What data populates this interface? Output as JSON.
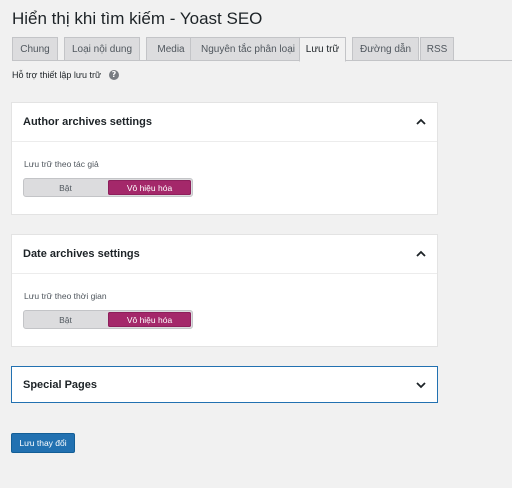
{
  "page": {
    "title": "Hiển thị khi tìm kiếm - Yoast SEO"
  },
  "tabs": [
    {
      "label": "Chung",
      "active": false
    },
    {
      "label": "Loại nội dung",
      "active": false
    },
    {
      "label": "Media",
      "active": false
    },
    {
      "label": "Nguyên tắc phân loại",
      "active": false
    },
    {
      "label": "Lưu trữ",
      "active": true
    },
    {
      "label": "Đường dẫn",
      "active": false
    },
    {
      "label": "RSS",
      "active": false
    }
  ],
  "help": {
    "text": "Hỗ trợ thiết lập lưu trữ",
    "icon": "question-circle-icon"
  },
  "author_panel": {
    "title": "Author archives settings",
    "field_label": "Lưu trữ theo tác giả",
    "options": [
      "Bật",
      "Vô hiệu hóa"
    ],
    "selected": "Vô hiệu hóa",
    "expanded": true
  },
  "date_panel": {
    "title": "Date archives settings",
    "field_label": "Lưu trữ theo thời gian",
    "options": [
      "Bật",
      "Vô hiệu hóa"
    ],
    "selected": "Vô hiệu hóa",
    "expanded": true
  },
  "special_panel": {
    "title": "Special Pages",
    "expanded": false
  },
  "save_button": {
    "label": "Lưu thay đổi"
  },
  "colors": {
    "accent": "#a4286a",
    "primary_button": "#2271b1",
    "focus_border": "#2271b1",
    "background": "#f1f1f1"
  }
}
